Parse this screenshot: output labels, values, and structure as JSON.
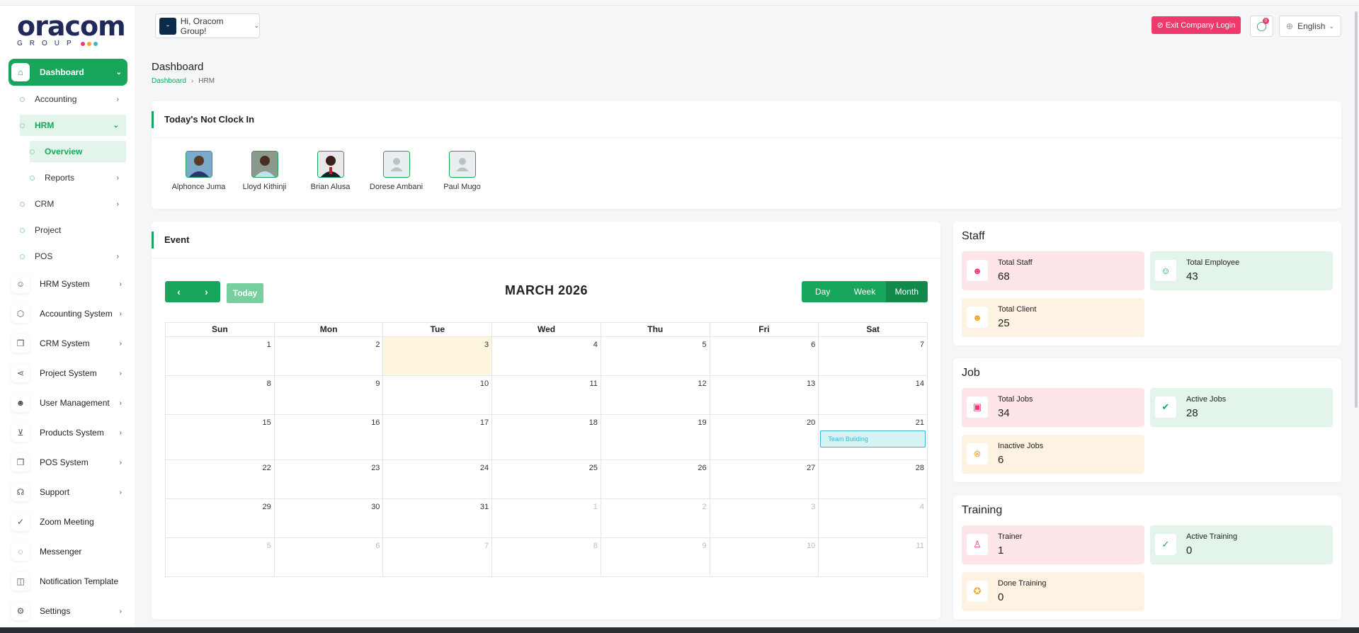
{
  "brand": {
    "name": "oracom",
    "sub": "GROUP",
    "dot_colors": [
      "#ee3a6a",
      "#f4a32c",
      "#3bb6c9"
    ]
  },
  "sidebar": {
    "dashboard": "Dashboard",
    "accounting": "Accounting",
    "hrm": "HRM",
    "overview": "Overview",
    "reports": "Reports",
    "crm": "CRM",
    "project": "Project",
    "pos": "POS",
    "items": [
      {
        "label": "HRM System",
        "icon": "user-icon"
      },
      {
        "label": "Accounting System",
        "icon": "box-icon"
      },
      {
        "label": "CRM System",
        "icon": "layers-icon"
      },
      {
        "label": "Project System",
        "icon": "share-icon"
      },
      {
        "label": "User Management",
        "icon": "users-icon"
      },
      {
        "label": "Products System",
        "icon": "cart-icon"
      },
      {
        "label": "POS System",
        "icon": "layers-icon"
      },
      {
        "label": "Support",
        "icon": "headset-icon"
      },
      {
        "label": "Zoom Meeting",
        "icon": "user-check-icon"
      },
      {
        "label": "Messenger",
        "icon": "chat-icon"
      },
      {
        "label": "Notification Template",
        "icon": "notification-icon"
      },
      {
        "label": "Settings",
        "icon": "gear-icon"
      }
    ]
  },
  "header": {
    "company_label": "Hi, Oracom Group!",
    "exit_label": "Exit Company Login",
    "chat_badge": "0",
    "language": "English"
  },
  "page": {
    "title": "Dashboard",
    "breadcrumb_home": "Dashboard",
    "breadcrumb_current": "HRM"
  },
  "not_clock_in": {
    "title": "Today's Not Clock In",
    "people": [
      {
        "name": "Alphonce Juma",
        "photo": "photo"
      },
      {
        "name": "Lloyd Kithinji",
        "photo": "photo"
      },
      {
        "name": "Brian Alusa",
        "photo": "photo"
      },
      {
        "name": "Dorese Ambani",
        "photo": "placeholder"
      },
      {
        "name": "Paul Mugo",
        "photo": "placeholder"
      }
    ]
  },
  "event": {
    "title": "Event",
    "today_label": "Today",
    "month_title": "MARCH 2026",
    "views": [
      "Day",
      "Week",
      "Month"
    ],
    "active_view": "Month",
    "weekdays": [
      "Sun",
      "Mon",
      "Tue",
      "Wed",
      "Thu",
      "Fri",
      "Sat"
    ],
    "weeks": [
      [
        "1",
        "2",
        "3",
        "4",
        "5",
        "6",
        "7"
      ],
      [
        "8",
        "9",
        "10",
        "11",
        "12",
        "13",
        "14"
      ],
      [
        "15",
        "16",
        "17",
        "18",
        "19",
        "20",
        "21"
      ],
      [
        "22",
        "23",
        "24",
        "25",
        "26",
        "27",
        "28"
      ],
      [
        "29",
        "30",
        "31",
        "1",
        "2",
        "3",
        "4"
      ],
      [
        "5",
        "6",
        "7",
        "8",
        "9",
        "10",
        "11"
      ]
    ],
    "today_day": "3",
    "event_label": "Team Building",
    "event_day": "21"
  },
  "staff": {
    "title": "Staff",
    "total_staff_label": "Total Staff",
    "total_staff": "68",
    "total_employee_label": "Total Employee",
    "total_employee": "43",
    "total_client_label": "Total Client",
    "total_client": "25"
  },
  "job": {
    "title": "Job",
    "total_jobs_label": "Total Jobs",
    "total_jobs": "34",
    "active_jobs_label": "Active Jobs",
    "active_jobs": "28",
    "inactive_jobs_label": "Inactive Jobs",
    "inactive_jobs": "6"
  },
  "training": {
    "title": "Training",
    "trainer_label": "Trainer",
    "trainer": "1",
    "active_training_label": "Active Training",
    "active_training": "0",
    "done_training_label": "Done Training",
    "done_training": "0"
  },
  "colors": {
    "accent": "#18a65c",
    "danger": "#ee3a6a",
    "event": "#3bb6c9"
  }
}
